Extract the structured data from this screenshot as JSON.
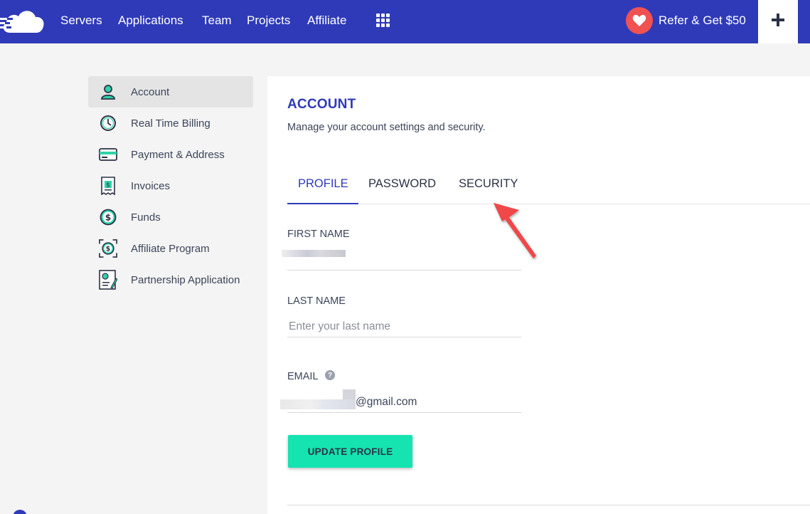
{
  "nav": {
    "items": [
      {
        "label": "Servers"
      },
      {
        "label": "Applications"
      },
      {
        "label": "Team"
      },
      {
        "label": "Projects"
      },
      {
        "label": "Affiliate"
      }
    ],
    "refer_label": "Refer & Get $50",
    "plus_label": "+"
  },
  "sidebar": {
    "items": [
      {
        "label": "Account",
        "icon": "user-icon",
        "active": true
      },
      {
        "label": "Real Time Billing",
        "icon": "clock-icon"
      },
      {
        "label": "Payment & Address",
        "icon": "credit-card-icon"
      },
      {
        "label": "Invoices",
        "icon": "invoice-icon"
      },
      {
        "label": "Funds",
        "icon": "dollar-coin-icon"
      },
      {
        "label": "Affiliate Program",
        "icon": "affiliate-dollar-icon"
      },
      {
        "label": "Partnership Application",
        "icon": "certificate-icon"
      }
    ]
  },
  "main": {
    "title": "ACCOUNT",
    "subtitle": "Manage your account settings and security.",
    "tabs": [
      {
        "label": "PROFILE",
        "active": true
      },
      {
        "label": "PASSWORD"
      },
      {
        "label": "SECURITY"
      }
    ],
    "form": {
      "first_name_label": "FIRST NAME",
      "last_name_label": "LAST NAME",
      "last_name_placeholder": "Enter your last name",
      "email_label": "EMAIL",
      "email_help": "?",
      "email_visible": "@gmail.com",
      "submit_label": "UPDATE PROFILE"
    }
  },
  "colors": {
    "brand": "#2f3ab8",
    "accent_button": "#15e3b0",
    "heart": "#f05252",
    "annotation_arrow": "#f0474a"
  }
}
